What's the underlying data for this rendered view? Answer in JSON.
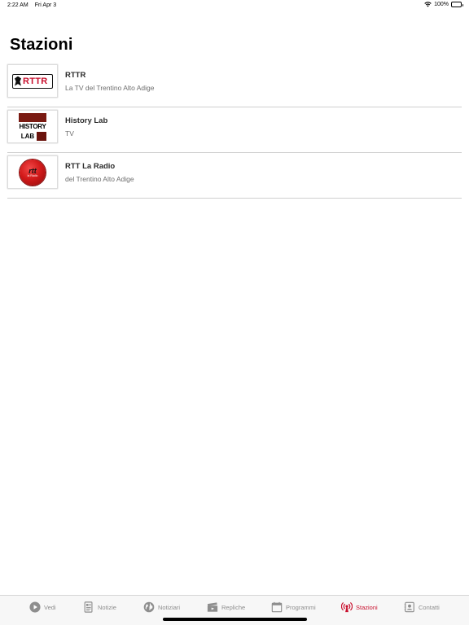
{
  "status_bar": {
    "time": "2:22 AM",
    "date": "Fri Apr 3",
    "battery": "100%"
  },
  "page": {
    "title": "Stazioni"
  },
  "stations": [
    {
      "name": "RTTR",
      "description": "La TV del Trentino Alto Adige",
      "logo": "rttr-logo",
      "logo_text": "RTTR"
    },
    {
      "name": "History Lab",
      "description": "TV",
      "logo": "history-lab-logo",
      "logo_text_top": "HISTORY",
      "logo_text_bottom": "LAB"
    },
    {
      "name": "RTT La Radio",
      "description": "del Trentino Alto Adige",
      "logo": "rtt-radio-logo",
      "logo_text": "rtt",
      "logo_subtext": "la Radio"
    }
  ],
  "tab_bar": {
    "active_color": "#c8102e",
    "inactive_color": "#8e8e8e",
    "tabs": [
      {
        "label": "Vedi",
        "icon": "play-icon",
        "active": false
      },
      {
        "label": "Notizie",
        "icon": "document-icon",
        "active": false
      },
      {
        "label": "Notiziari",
        "icon": "globe-icon",
        "active": false
      },
      {
        "label": "Repliche",
        "icon": "clapperboard-icon",
        "active": false
      },
      {
        "label": "Programmi",
        "icon": "calendar-icon",
        "active": false
      },
      {
        "label": "Stazioni",
        "icon": "broadcast-icon",
        "active": true
      },
      {
        "label": "Contatti",
        "icon": "contacts-icon",
        "active": false
      }
    ]
  }
}
